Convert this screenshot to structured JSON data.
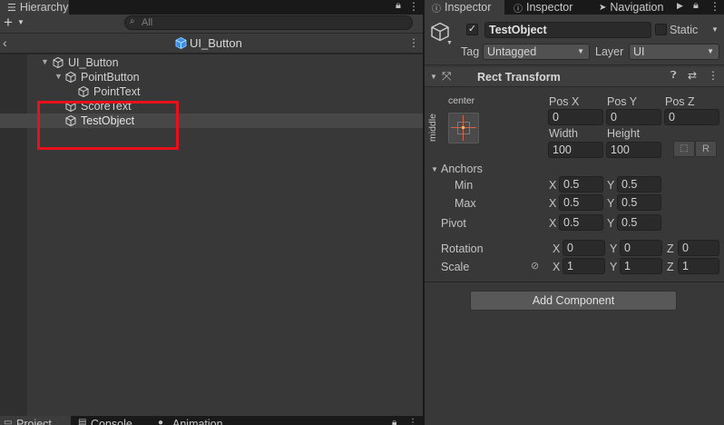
{
  "hierarchy": {
    "tab_label": "Hierarchy",
    "search_placeholder": "All",
    "scene_title": "UI_Button",
    "items": [
      {
        "label": "UI_Button",
        "expanded": true
      },
      {
        "label": "PointButton",
        "expanded": true
      },
      {
        "label": "PointText"
      },
      {
        "label": "ScoreText"
      },
      {
        "label": "TestObject",
        "selected": true
      }
    ],
    "highlight_color": "#e8101a"
  },
  "inspector": {
    "tabs": [
      {
        "label": "Inspector"
      },
      {
        "label": "Inspector"
      },
      {
        "label": "Navigation"
      }
    ],
    "object_name": "TestObject",
    "active_checked": true,
    "static_label": "Static",
    "tag_label": "Tag",
    "tag_value": "Untagged",
    "layer_label": "Layer",
    "layer_value": "UI",
    "component": {
      "title": "Rect Transform",
      "anchor_preset_h": "center",
      "anchor_preset_v": "middle",
      "pos_x_label": "Pos X",
      "pos_y_label": "Pos Y",
      "pos_z_label": "Pos Z",
      "pos_x": "0",
      "pos_y": "0",
      "pos_z": "0",
      "width_label": "Width",
      "height_label": "Height",
      "width": "100",
      "height": "100",
      "r_button": "R",
      "anchors_label": "Anchors",
      "min_label": "Min",
      "max_label": "Max",
      "pivot_label": "Pivot",
      "x_letter": "X",
      "y_letter": "Y",
      "z_letter": "Z",
      "min_x": "0.5",
      "min_y": "0.5",
      "max_x": "0.5",
      "max_y": "0.5",
      "pivot_x": "0.5",
      "pivot_y": "0.5",
      "rotation_label": "Rotation",
      "rot_x": "0",
      "rot_y": "0",
      "rot_z": "0",
      "scale_label": "Scale",
      "scale_x": "1",
      "scale_y": "1",
      "scale_z": "1"
    },
    "add_component_label": "Add Component"
  },
  "bottom_tabs": [
    {
      "label": "Project"
    },
    {
      "label": "Console"
    },
    {
      "label": "Animation"
    }
  ]
}
